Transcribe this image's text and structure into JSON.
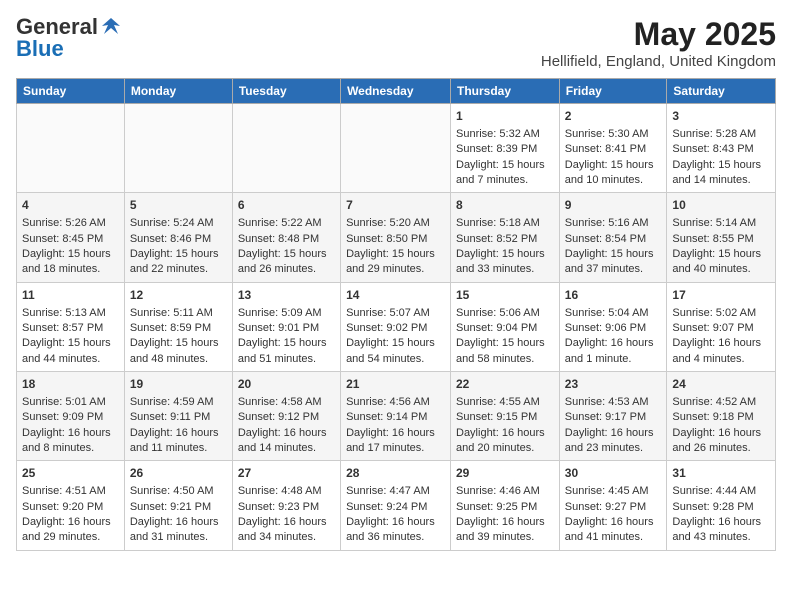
{
  "header": {
    "logo_general": "General",
    "logo_blue": "Blue",
    "month": "May 2025",
    "location": "Hellifield, England, United Kingdom"
  },
  "days_of_week": [
    "Sunday",
    "Monday",
    "Tuesday",
    "Wednesday",
    "Thursday",
    "Friday",
    "Saturday"
  ],
  "weeks": [
    [
      {
        "day": "",
        "content": ""
      },
      {
        "day": "",
        "content": ""
      },
      {
        "day": "",
        "content": ""
      },
      {
        "day": "",
        "content": ""
      },
      {
        "day": "1",
        "content": "Sunrise: 5:32 AM\nSunset: 8:39 PM\nDaylight: 15 hours\nand 7 minutes."
      },
      {
        "day": "2",
        "content": "Sunrise: 5:30 AM\nSunset: 8:41 PM\nDaylight: 15 hours\nand 10 minutes."
      },
      {
        "day": "3",
        "content": "Sunrise: 5:28 AM\nSunset: 8:43 PM\nDaylight: 15 hours\nand 14 minutes."
      }
    ],
    [
      {
        "day": "4",
        "content": "Sunrise: 5:26 AM\nSunset: 8:45 PM\nDaylight: 15 hours\nand 18 minutes."
      },
      {
        "day": "5",
        "content": "Sunrise: 5:24 AM\nSunset: 8:46 PM\nDaylight: 15 hours\nand 22 minutes."
      },
      {
        "day": "6",
        "content": "Sunrise: 5:22 AM\nSunset: 8:48 PM\nDaylight: 15 hours\nand 26 minutes."
      },
      {
        "day": "7",
        "content": "Sunrise: 5:20 AM\nSunset: 8:50 PM\nDaylight: 15 hours\nand 29 minutes."
      },
      {
        "day": "8",
        "content": "Sunrise: 5:18 AM\nSunset: 8:52 PM\nDaylight: 15 hours\nand 33 minutes."
      },
      {
        "day": "9",
        "content": "Sunrise: 5:16 AM\nSunset: 8:54 PM\nDaylight: 15 hours\nand 37 minutes."
      },
      {
        "day": "10",
        "content": "Sunrise: 5:14 AM\nSunset: 8:55 PM\nDaylight: 15 hours\nand 40 minutes."
      }
    ],
    [
      {
        "day": "11",
        "content": "Sunrise: 5:13 AM\nSunset: 8:57 PM\nDaylight: 15 hours\nand 44 minutes."
      },
      {
        "day": "12",
        "content": "Sunrise: 5:11 AM\nSunset: 8:59 PM\nDaylight: 15 hours\nand 48 minutes."
      },
      {
        "day": "13",
        "content": "Sunrise: 5:09 AM\nSunset: 9:01 PM\nDaylight: 15 hours\nand 51 minutes."
      },
      {
        "day": "14",
        "content": "Sunrise: 5:07 AM\nSunset: 9:02 PM\nDaylight: 15 hours\nand 54 minutes."
      },
      {
        "day": "15",
        "content": "Sunrise: 5:06 AM\nSunset: 9:04 PM\nDaylight: 15 hours\nand 58 minutes."
      },
      {
        "day": "16",
        "content": "Sunrise: 5:04 AM\nSunset: 9:06 PM\nDaylight: 16 hours\nand 1 minute."
      },
      {
        "day": "17",
        "content": "Sunrise: 5:02 AM\nSunset: 9:07 PM\nDaylight: 16 hours\nand 4 minutes."
      }
    ],
    [
      {
        "day": "18",
        "content": "Sunrise: 5:01 AM\nSunset: 9:09 PM\nDaylight: 16 hours\nand 8 minutes."
      },
      {
        "day": "19",
        "content": "Sunrise: 4:59 AM\nSunset: 9:11 PM\nDaylight: 16 hours\nand 11 minutes."
      },
      {
        "day": "20",
        "content": "Sunrise: 4:58 AM\nSunset: 9:12 PM\nDaylight: 16 hours\nand 14 minutes."
      },
      {
        "day": "21",
        "content": "Sunrise: 4:56 AM\nSunset: 9:14 PM\nDaylight: 16 hours\nand 17 minutes."
      },
      {
        "day": "22",
        "content": "Sunrise: 4:55 AM\nSunset: 9:15 PM\nDaylight: 16 hours\nand 20 minutes."
      },
      {
        "day": "23",
        "content": "Sunrise: 4:53 AM\nSunset: 9:17 PM\nDaylight: 16 hours\nand 23 minutes."
      },
      {
        "day": "24",
        "content": "Sunrise: 4:52 AM\nSunset: 9:18 PM\nDaylight: 16 hours\nand 26 minutes."
      }
    ],
    [
      {
        "day": "25",
        "content": "Sunrise: 4:51 AM\nSunset: 9:20 PM\nDaylight: 16 hours\nand 29 minutes."
      },
      {
        "day": "26",
        "content": "Sunrise: 4:50 AM\nSunset: 9:21 PM\nDaylight: 16 hours\nand 31 minutes."
      },
      {
        "day": "27",
        "content": "Sunrise: 4:48 AM\nSunset: 9:23 PM\nDaylight: 16 hours\nand 34 minutes."
      },
      {
        "day": "28",
        "content": "Sunrise: 4:47 AM\nSunset: 9:24 PM\nDaylight: 16 hours\nand 36 minutes."
      },
      {
        "day": "29",
        "content": "Sunrise: 4:46 AM\nSunset: 9:25 PM\nDaylight: 16 hours\nand 39 minutes."
      },
      {
        "day": "30",
        "content": "Sunrise: 4:45 AM\nSunset: 9:27 PM\nDaylight: 16 hours\nand 41 minutes."
      },
      {
        "day": "31",
        "content": "Sunrise: 4:44 AM\nSunset: 9:28 PM\nDaylight: 16 hours\nand 43 minutes."
      }
    ]
  ]
}
